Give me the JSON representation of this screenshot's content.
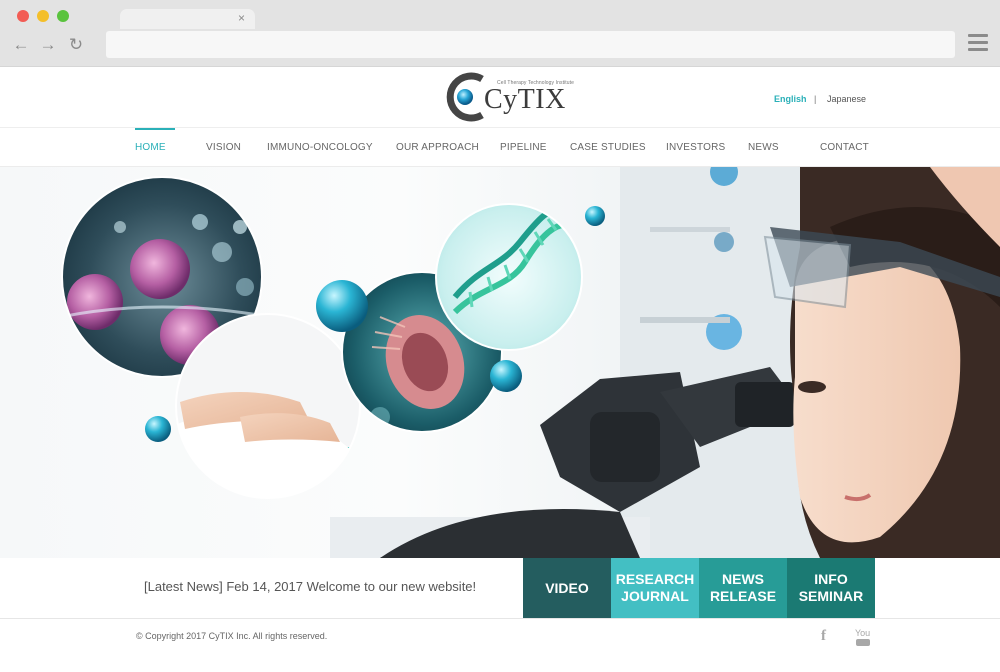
{
  "browser": {
    "tab_close": "×",
    "back_icon": "←",
    "forward_icon": "→",
    "reload_icon": "↻"
  },
  "header": {
    "logo_text": "CyTIX",
    "logo_tagline": "Cell Therapy Technology Institute",
    "lang_english": "English",
    "lang_separator": "|",
    "lang_japanese": "Japanese"
  },
  "nav": {
    "items": [
      {
        "label": "HOME",
        "active": true
      },
      {
        "label": "VISION"
      },
      {
        "label": "IMMUNO-ONCOLOGY"
      },
      {
        "label": "OUR APPROACH"
      },
      {
        "label": "PIPELINE"
      },
      {
        "label": "CASE STUDIES"
      },
      {
        "label": "INVESTORS"
      },
      {
        "label": "NEWS"
      },
      {
        "label": "CONTACT"
      }
    ]
  },
  "news": {
    "text": "[Latest News] Feb 14, 2017 Welcome to our new website!"
  },
  "cta": {
    "video": "VIDEO",
    "research": "RESEARCH\nJOURNAL",
    "release": "NEWS\nRELEASE",
    "seminar": "INFO\nSEMINAR",
    "colors": {
      "video": "#245d5f",
      "research": "#43bfc3",
      "release": "#279c97",
      "seminar": "#1b7a73"
    }
  },
  "footer": {
    "copyright": "© Copyright 2017 CyTIX Inc. All rights reserved.",
    "facebook_icon": "f",
    "youtube_icon": "You"
  },
  "colors": {
    "accent": "#2ab0b8"
  }
}
